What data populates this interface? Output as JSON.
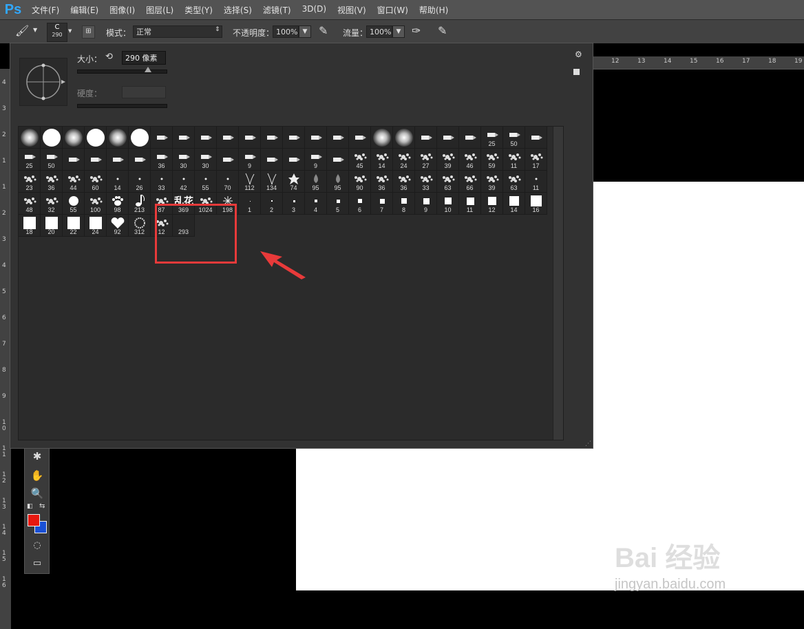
{
  "app": {
    "logo": "Ps"
  },
  "menu": {
    "items": [
      "文件(F)",
      "编辑(E)",
      "图像(I)",
      "图层(L)",
      "类型(Y)",
      "选择(S)",
      "滤镜(T)",
      "3D(D)",
      "视图(V)",
      "窗口(W)",
      "帮助(H)"
    ]
  },
  "options": {
    "brush_size_value": "290",
    "brush_size_letter": "C",
    "mode_label": "模式：",
    "mode_value": "正常",
    "opacity_label": "不透明度：",
    "opacity_value": "100%",
    "flow_label": "流量：",
    "flow_value": "100%"
  },
  "brush_panel": {
    "size_label": "大小：",
    "size_value": "290 像素",
    "hardness_label": "硬度：",
    "size_slider_fraction": 0.79,
    "brushes": [
      {
        "label": "",
        "shape": "soft-circle"
      },
      {
        "label": "",
        "shape": "hard-circle"
      },
      {
        "label": "",
        "shape": "soft-circle"
      },
      {
        "label": "",
        "shape": "hard-circle"
      },
      {
        "label": "",
        "shape": "soft-circle"
      },
      {
        "label": "",
        "shape": "hard-circle"
      },
      {
        "label": "",
        "shape": "pen"
      },
      {
        "label": "",
        "shape": "pen"
      },
      {
        "label": "",
        "shape": "pen"
      },
      {
        "label": "",
        "shape": "pen"
      },
      {
        "label": "",
        "shape": "pen"
      },
      {
        "label": "",
        "shape": "pen"
      },
      {
        "label": "",
        "shape": "pen"
      },
      {
        "label": "",
        "shape": "pen"
      },
      {
        "label": "",
        "shape": "pen"
      },
      {
        "label": "",
        "shape": "pen"
      },
      {
        "label": "",
        "shape": "soft-circle"
      },
      {
        "label": "",
        "shape": "soft-circle"
      },
      {
        "label": "",
        "shape": "pen"
      },
      {
        "label": "",
        "shape": "pen"
      },
      {
        "label": "",
        "shape": "pen"
      },
      {
        "label": "25",
        "shape": "pen"
      },
      {
        "label": "50",
        "shape": "pen"
      },
      {
        "label": "",
        "shape": "pen"
      },
      {
        "label": "25",
        "shape": "pen"
      },
      {
        "label": "50",
        "shape": "pen"
      },
      {
        "label": "",
        "shape": "pen"
      },
      {
        "label": "",
        "shape": "pen"
      },
      {
        "label": "",
        "shape": "pen"
      },
      {
        "label": "",
        "shape": "pen"
      },
      {
        "label": "36",
        "shape": "pen"
      },
      {
        "label": "30",
        "shape": "pen"
      },
      {
        "label": "30",
        "shape": "pen"
      },
      {
        "label": "",
        "shape": "pen"
      },
      {
        "label": "9",
        "shape": "pen"
      },
      {
        "label": "",
        "shape": "pen"
      },
      {
        "label": "",
        "shape": "pen"
      },
      {
        "label": "9",
        "shape": "pen"
      },
      {
        "label": "",
        "shape": "pen"
      },
      {
        "label": "45",
        "shape": "texture"
      },
      {
        "label": "14",
        "shape": "texture"
      },
      {
        "label": "24",
        "shape": "texture"
      },
      {
        "label": "27",
        "shape": "texture"
      },
      {
        "label": "39",
        "shape": "texture"
      },
      {
        "label": "46",
        "shape": "texture"
      },
      {
        "label": "59",
        "shape": "texture"
      },
      {
        "label": "11",
        "shape": "texture"
      },
      {
        "label": "17",
        "shape": "texture"
      },
      {
        "label": "23",
        "shape": "texture"
      },
      {
        "label": "36",
        "shape": "texture"
      },
      {
        "label": "44",
        "shape": "texture"
      },
      {
        "label": "60",
        "shape": "texture"
      },
      {
        "label": "14",
        "shape": "dot"
      },
      {
        "label": "26",
        "shape": "dot"
      },
      {
        "label": "33",
        "shape": "dot"
      },
      {
        "label": "42",
        "shape": "dot"
      },
      {
        "label": "55",
        "shape": "dot"
      },
      {
        "label": "70",
        "shape": "dot"
      },
      {
        "label": "112",
        "shape": "grass"
      },
      {
        "label": "134",
        "shape": "grass"
      },
      {
        "label": "74",
        "shape": "leaf"
      },
      {
        "label": "95",
        "shape": "drop"
      },
      {
        "label": "95",
        "shape": "drop"
      },
      {
        "label": "90",
        "shape": "texture"
      },
      {
        "label": "36",
        "shape": "texture"
      },
      {
        "label": "36",
        "shape": "texture"
      },
      {
        "label": "33",
        "shape": "texture"
      },
      {
        "label": "63",
        "shape": "texture"
      },
      {
        "label": "66",
        "shape": "texture"
      },
      {
        "label": "39",
        "shape": "texture"
      },
      {
        "label": "63",
        "shape": "texture"
      },
      {
        "label": "11",
        "shape": "dot"
      },
      {
        "label": "48",
        "shape": "texture"
      },
      {
        "label": "32",
        "shape": "texture"
      },
      {
        "label": "55",
        "shape": "hard-circle"
      },
      {
        "label": "100",
        "shape": "texture"
      },
      {
        "label": "98",
        "shape": "paw"
      },
      {
        "label": "213",
        "shape": "note"
      },
      {
        "label": "87",
        "shape": "texture"
      },
      {
        "label": "369",
        "shape": "text"
      },
      {
        "label": "1024",
        "shape": "texture"
      },
      {
        "label": "198",
        "shape": "star"
      },
      {
        "label": "1",
        "shape": "square"
      },
      {
        "label": "2",
        "shape": "square"
      },
      {
        "label": "3",
        "shape": "square"
      },
      {
        "label": "4",
        "shape": "square"
      },
      {
        "label": "5",
        "shape": "square"
      },
      {
        "label": "6",
        "shape": "square"
      },
      {
        "label": "7",
        "shape": "square"
      },
      {
        "label": "8",
        "shape": "square"
      },
      {
        "label": "9",
        "shape": "square"
      },
      {
        "label": "10",
        "shape": "square"
      },
      {
        "label": "11",
        "shape": "square"
      },
      {
        "label": "12",
        "shape": "square"
      },
      {
        "label": "14",
        "shape": "square"
      },
      {
        "label": "16",
        "shape": "square"
      },
      {
        "label": "18",
        "shape": "square"
      },
      {
        "label": "20",
        "shape": "square"
      },
      {
        "label": "22",
        "shape": "square"
      },
      {
        "label": "24",
        "shape": "square"
      },
      {
        "label": "92",
        "shape": "heart"
      },
      {
        "label": "312",
        "shape": "ring"
      },
      {
        "label": "12",
        "shape": "texture"
      },
      {
        "label": "293",
        "shape": "crescent"
      }
    ],
    "text_brush_glyphs": "乱花"
  },
  "rulers": {
    "top": [
      "12",
      "13",
      "14",
      "15",
      "16",
      "17",
      "18",
      "19"
    ],
    "left": [
      "4",
      "3",
      "2",
      "1",
      "1",
      "2",
      "3",
      "4",
      "5",
      "6",
      "7",
      "8",
      "9",
      "1 0",
      "1 1",
      "1 2",
      "1 3",
      "1 4",
      "1 5",
      "1 6"
    ]
  },
  "watermark": {
    "logo": "Bai  经验",
    "url": "jingyan.baidu.com"
  },
  "colors": {
    "foreground": "#e8180f",
    "background": "#1a50d6",
    "highlight": "#e83a3a"
  }
}
